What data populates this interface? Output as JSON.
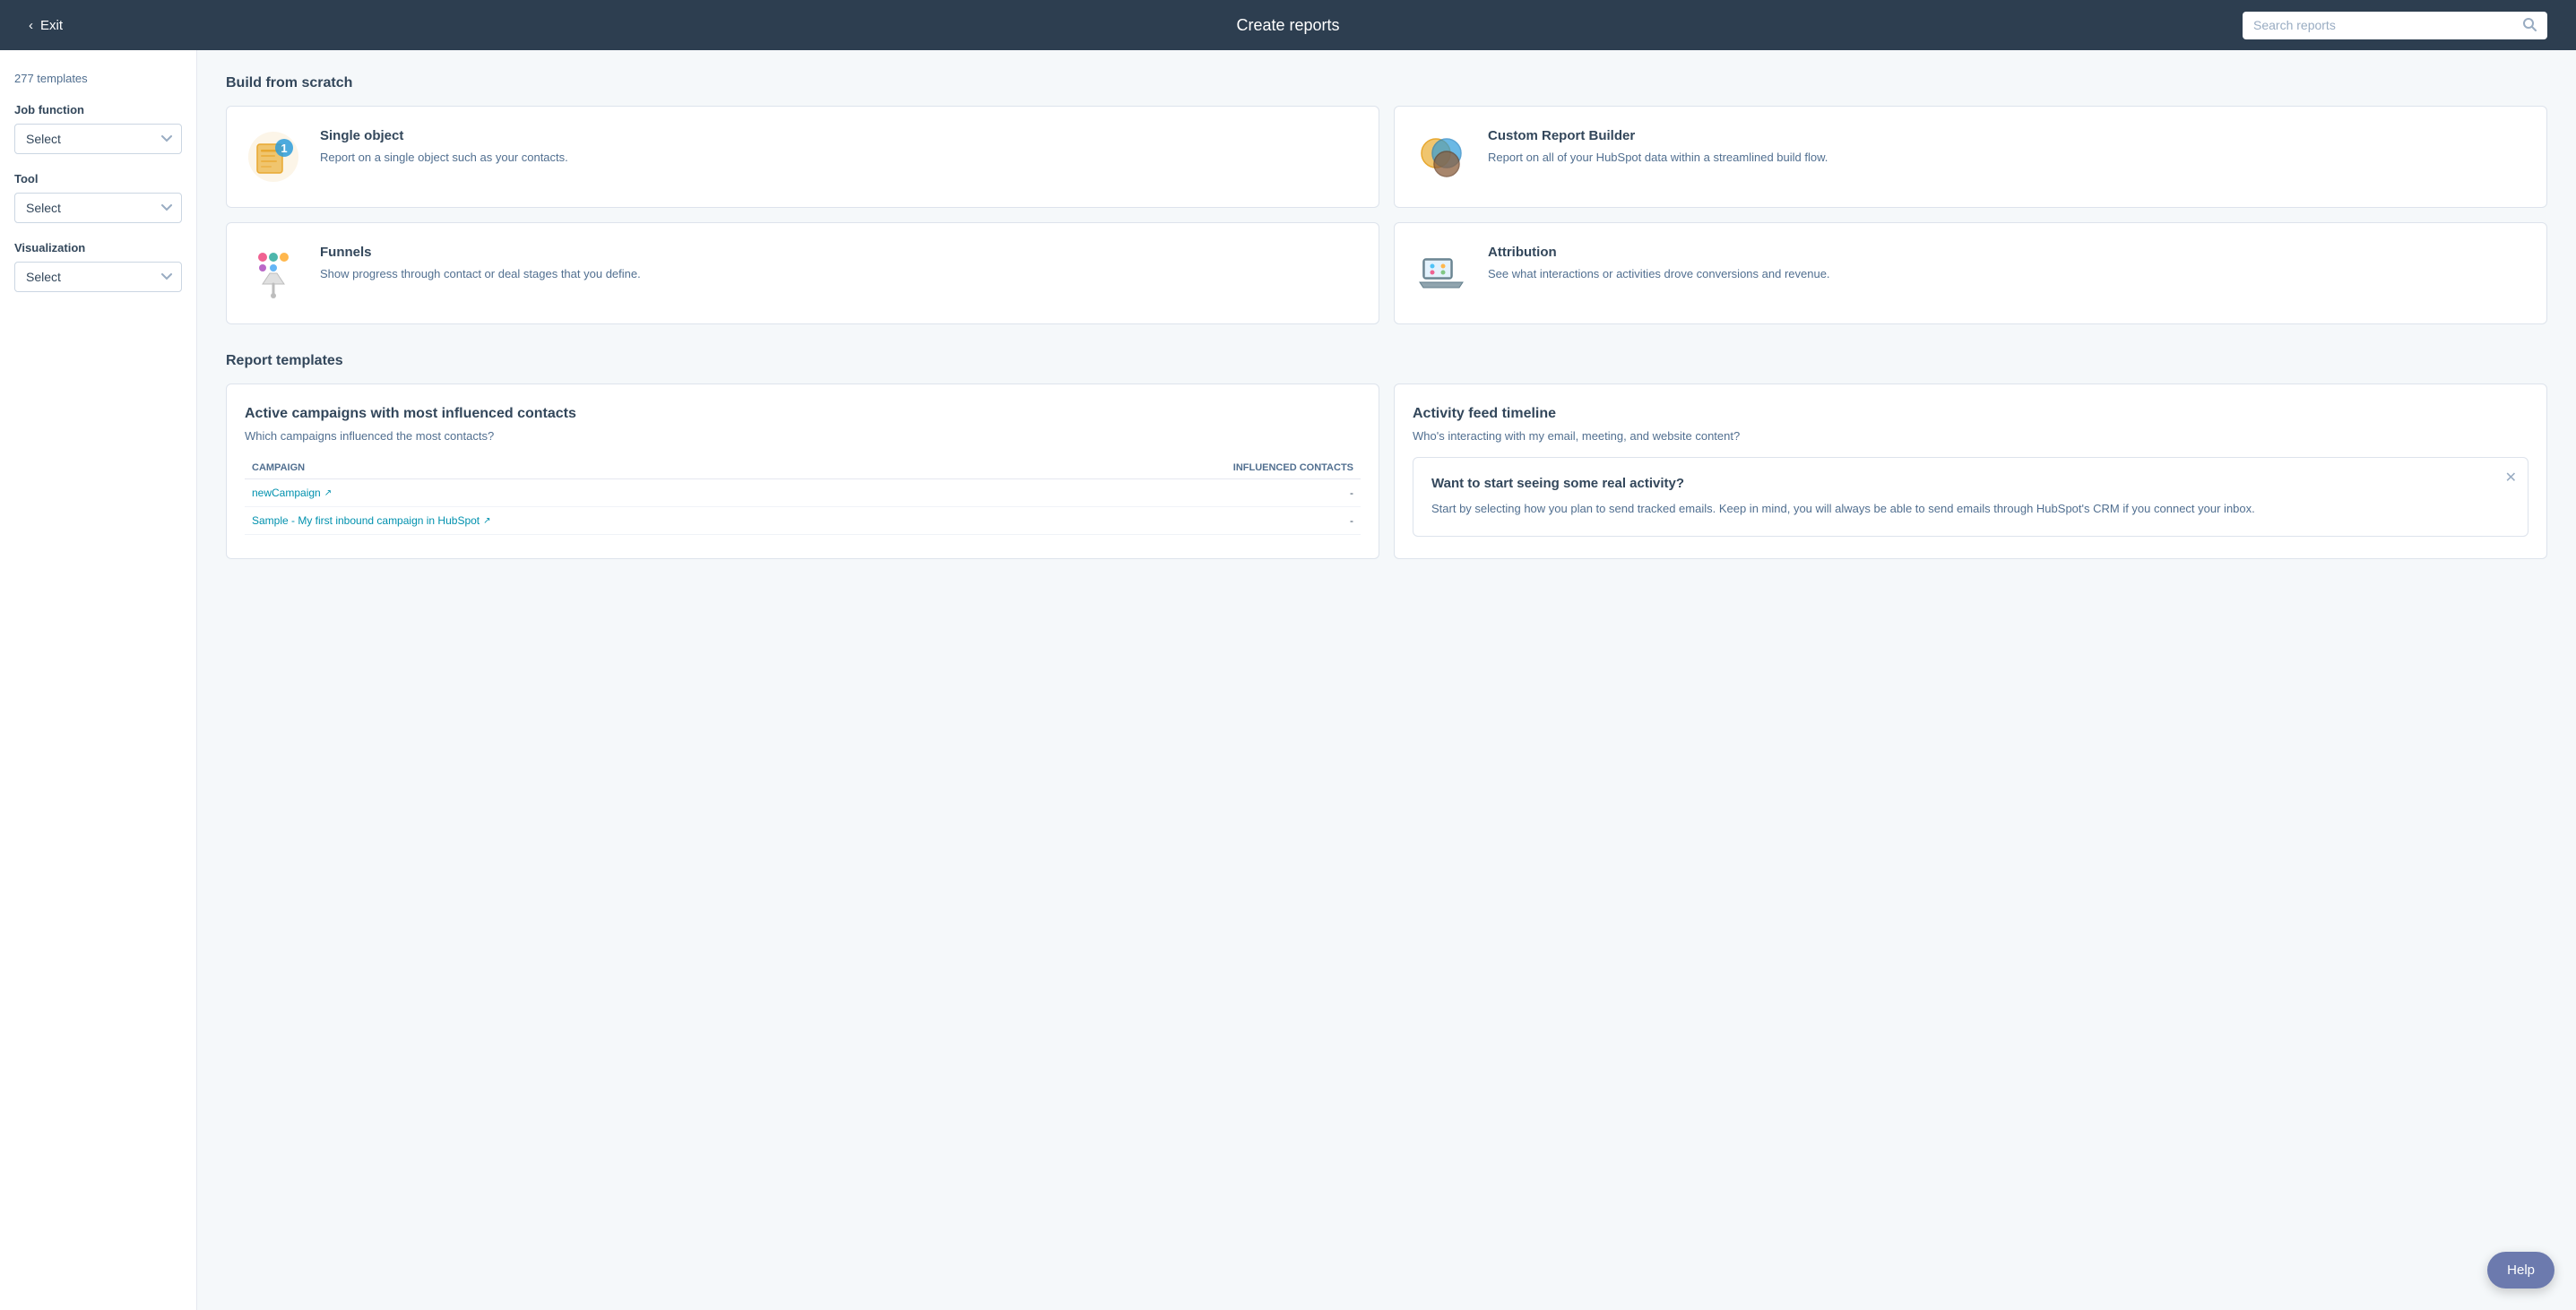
{
  "header": {
    "exit_label": "Exit",
    "title": "Create reports",
    "search_placeholder": "Search reports"
  },
  "sidebar": {
    "count": "277 templates",
    "job_function_label": "Job function",
    "job_function_placeholder": "Select",
    "tool_label": "Tool",
    "tool_placeholder": "Select",
    "visualization_label": "Visualization",
    "visualization_placeholder": "Select"
  },
  "build_section": {
    "title": "Build from scratch",
    "cards": [
      {
        "id": "single-object",
        "title": "Single object",
        "description": "Report on a single object such as your contacts."
      },
      {
        "id": "custom-report-builder",
        "title": "Custom Report Builder",
        "description": "Report on all of your HubSpot data within a streamlined build flow."
      },
      {
        "id": "funnels",
        "title": "Funnels",
        "description": "Show progress through contact or deal stages that you define."
      },
      {
        "id": "attribution",
        "title": "Attribution",
        "description": "See what interactions or activities drove conversions and revenue."
      }
    ]
  },
  "templates_section": {
    "title": "Report templates",
    "cards": [
      {
        "id": "active-campaigns",
        "title": "Active campaigns with most influenced contacts",
        "subtitle": "Which campaigns influenced the most contacts?",
        "table": {
          "col1_header": "CAMPAIGN",
          "col2_header": "INFLUENCED CONTACTS",
          "rows": [
            {
              "campaign": "newCampaign",
              "value": "-"
            },
            {
              "campaign": "Sample - My first inbound campaign in HubSpot",
              "value": "-"
            }
          ]
        }
      },
      {
        "id": "activity-feed-timeline",
        "title": "Activity feed timeline",
        "subtitle": "Who's interacting with my email, meeting, and website content?",
        "overlay": {
          "heading": "Want to start seeing some real activity?",
          "body": "Start by selecting how you plan to send tracked emails. Keep in mind, you will always be able to send emails through HubSpot's CRM if you connect your inbox."
        }
      }
    ]
  },
  "help_button_label": "Help"
}
